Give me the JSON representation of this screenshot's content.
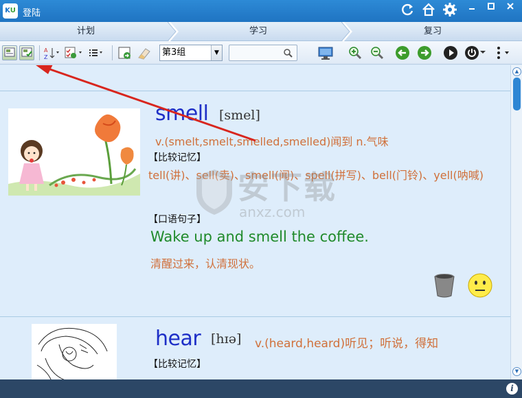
{
  "window": {
    "title": "登陆",
    "logo": "KU",
    "controls": [
      "refresh-icon",
      "home-icon",
      "gear-icon",
      "minimize-icon",
      "maximize-icon",
      "close-icon"
    ]
  },
  "tabs": [
    {
      "label": "计划"
    },
    {
      "label": "学习"
    },
    {
      "label": "复习"
    }
  ],
  "toolbar": {
    "group_selected": "第3组",
    "search_placeholder": "",
    "icons": [
      "card-view-icon",
      "check-card-icon",
      "sort-az-icon",
      "checklist-icon",
      "list-icon",
      "export-icon",
      "eraser-icon",
      "monitor-icon",
      "zoom-in-icon",
      "zoom-out-icon",
      "prev-icon",
      "next-icon",
      "play-icon",
      "power-icon",
      "more-icon"
    ]
  },
  "entries": [
    {
      "word": "smell",
      "phonetic": "[smel]",
      "definition": "v.(smelt,smelt,smelled,smelled)闻到 n.气味",
      "compare_label": "【比较记忆】",
      "related": "tell(讲)、sell(卖)、smell(闻)、spell(拼写)、bell(门铃)、yell(呐喊)",
      "phrase_label": "【口语句子】",
      "sentence": "Wake up and smell the coffee.",
      "translation": "清醒过来，认清现状。"
    },
    {
      "word": "hear",
      "phonetic": "[hɪə]",
      "definition": "v.(heard,heard)听见；听说，得知",
      "compare_label": "【比较记忆】"
    }
  ],
  "watermark": {
    "text": "安下载",
    "url": "anxz.com"
  }
}
